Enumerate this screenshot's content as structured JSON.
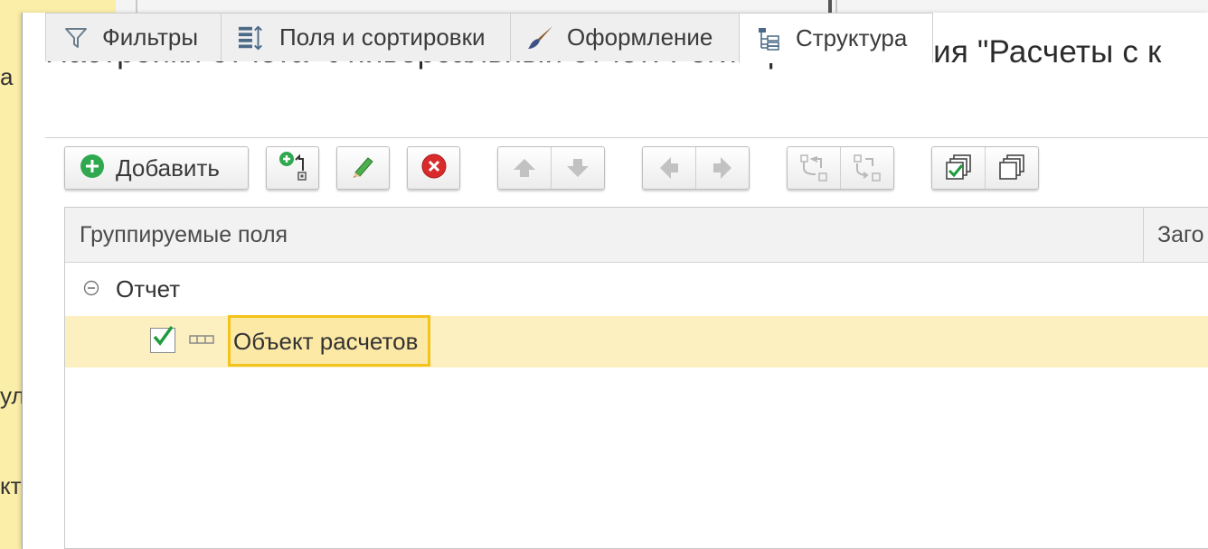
{
  "background": {
    "fragments": [
      "а",
      "ул",
      "кти"
    ]
  },
  "dialog": {
    "title": "Настройки отчета \"Универсальный отчет: Регистр накопления \"Расчеты с к"
  },
  "tabs": [
    {
      "label": "Фильтры",
      "icon": "filter-icon"
    },
    {
      "label": "Поля и сортировки",
      "icon": "fields-sort-icon"
    },
    {
      "label": "Оформление",
      "icon": "brush-icon"
    },
    {
      "label": "Структура",
      "icon": "structure-tree-icon",
      "active": true
    }
  ],
  "toolbar": {
    "add_label": "Добавить",
    "icons": [
      "add-icon",
      "add-grouping-icon",
      "edit-icon",
      "delete-icon",
      "move-up-icon",
      "move-down-icon",
      "move-left-icon",
      "move-right-icon",
      "group-icon",
      "ungroup-icon",
      "check-all-icon",
      "uncheck-all-icon"
    ]
  },
  "table": {
    "columns": [
      "Группируемые поля",
      "Заго"
    ],
    "rows": [
      {
        "label": "Отчет",
        "level": 0
      },
      {
        "label": "Объект расчетов",
        "level": 1,
        "checked": true,
        "selected": true
      }
    ]
  },
  "colors": {
    "accent_yellow": "#f3c21b",
    "selected_row": "#fcefc0",
    "add_green": "#2fa84f",
    "delete_red": "#d92b2b",
    "check_green": "#1f9a3a"
  }
}
